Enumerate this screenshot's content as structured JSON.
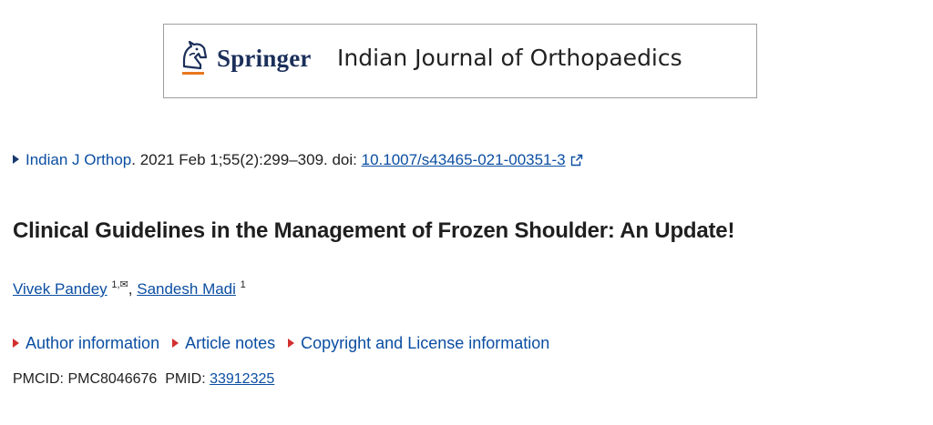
{
  "banner": {
    "publisher": "Springer",
    "journal": "Indian Journal of Orthopaedics"
  },
  "citation": {
    "journal_abbrev": "Indian J Orthop",
    "details": ". 2021 Feb 1;55(2):299–309. doi: ",
    "doi": "10.1007/s43465-021-00351-3"
  },
  "article": {
    "title": "Clinical Guidelines in the Management of Frozen Shoulder: An Update!"
  },
  "authors": [
    {
      "name": "Vivek Pandey",
      "affiliation": "1,✉"
    },
    {
      "name": "Sandesh Madi",
      "affiliation": "1"
    }
  ],
  "authors_separator": ", ",
  "sections": [
    "Author information",
    "Article notes",
    "Copyright and License information"
  ],
  "ids": {
    "pmcid_label": "PMCID: ",
    "pmcid": "PMC8046676",
    "pmid_label": "PMID: ",
    "pmid": "33912325"
  },
  "colors": {
    "link": "#0b4ea2",
    "bullet_red": "#d32f2f",
    "bullet_blue": "#1a3a6e",
    "publisher_text": "#1b2f5a",
    "publisher_accent": "#e8771e"
  },
  "icons": {
    "publisher_logo": "springer-horse-icon",
    "external_link": "external-link-icon"
  }
}
